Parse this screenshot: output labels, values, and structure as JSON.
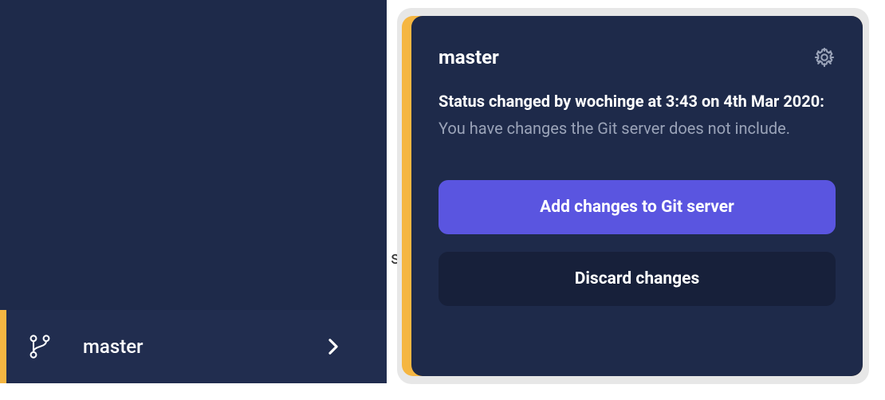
{
  "sidebar": {
    "branch_label": "master"
  },
  "popup": {
    "title": "master",
    "status_prefix": "Status changed by wochinge at 3:43 on 4th Mar 2020:",
    "status_detail": " You have changes the Git server does not include.",
    "primary_button": "Add changes to Git server",
    "secondary_button": "Discard changes"
  },
  "background_char": "s"
}
